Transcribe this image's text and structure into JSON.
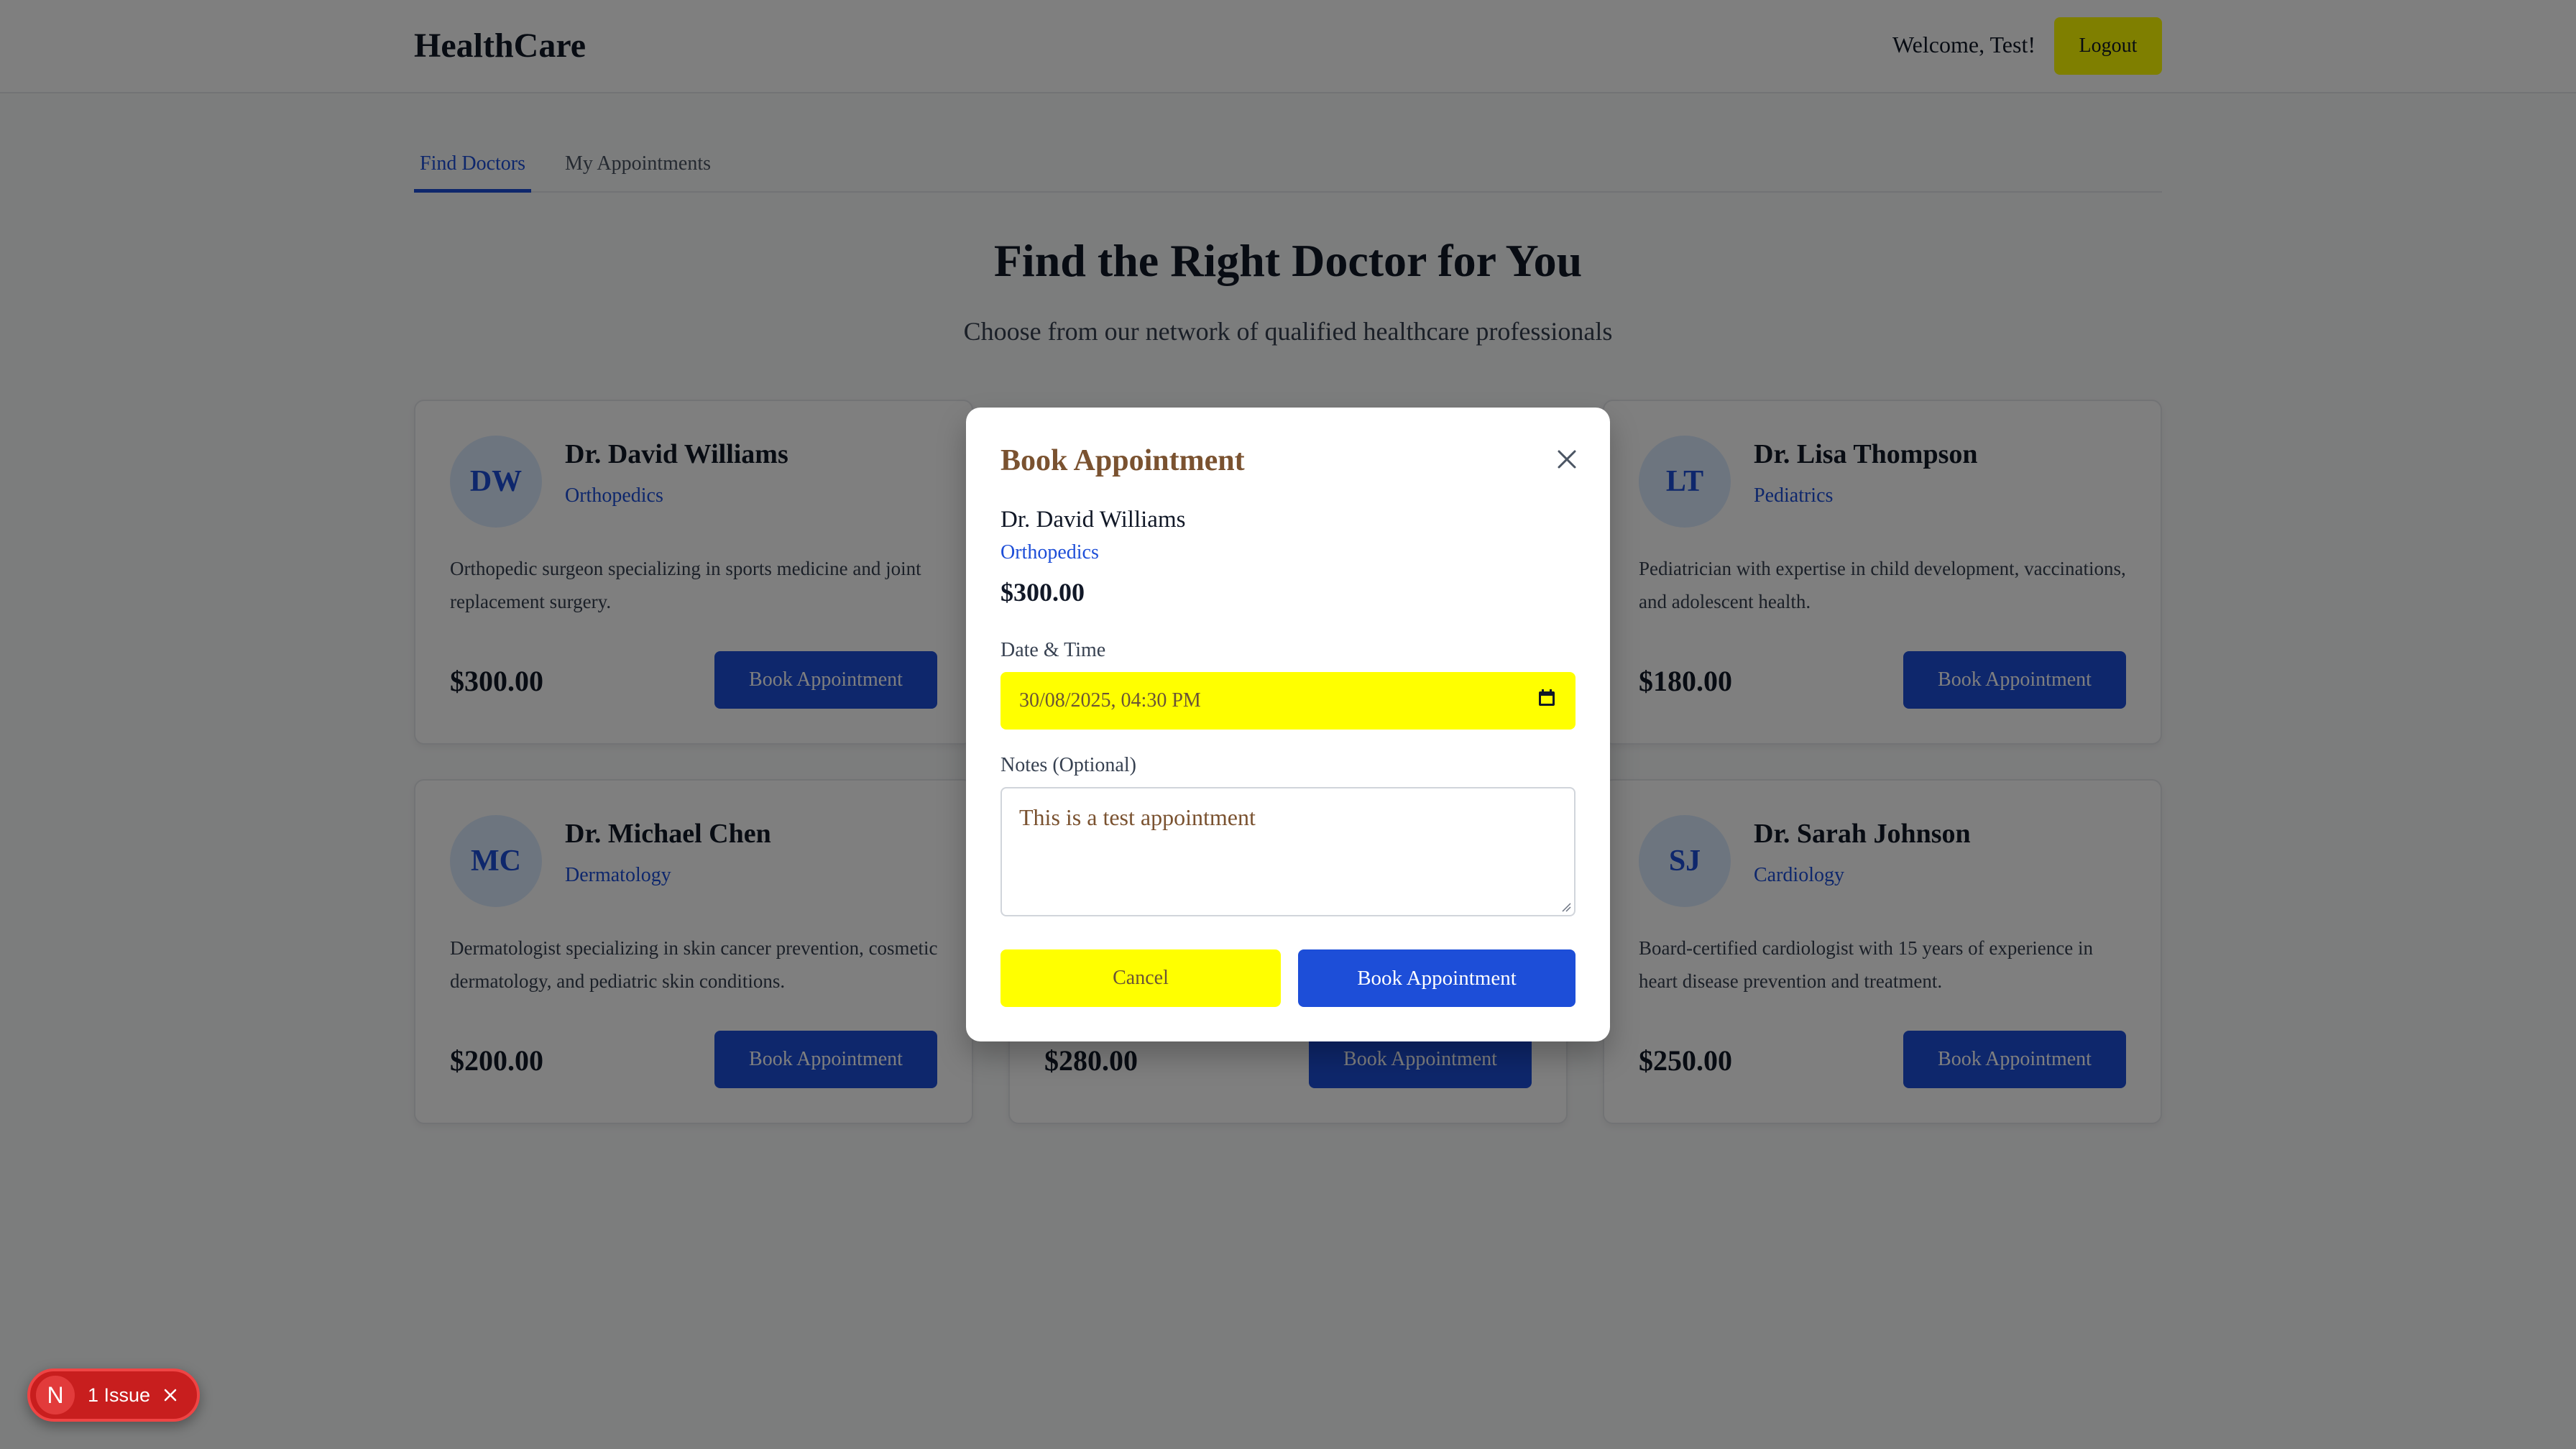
{
  "header": {
    "brand": "HealthCare",
    "welcome": "Welcome, Test!",
    "logout_label": "Logout"
  },
  "tabs": [
    {
      "label": "Find Doctors",
      "active": true
    },
    {
      "label": "My Appointments",
      "active": false
    }
  ],
  "hero": {
    "title": "Find the Right Doctor for You",
    "subtitle": "Choose from our network of qualified healthcare professionals"
  },
  "doctors": [
    {
      "initials": "DW",
      "name": "Dr. David Williams",
      "specialty": "Orthopedics",
      "description": "Orthopedic surgeon specializing in sports medicine and joint replacement surgery.",
      "price": "$300.00",
      "button": "Book Appointment"
    },
    {
      "initials": "LT",
      "name": "Dr. Lisa Thompson",
      "specialty": "Pediatrics",
      "description": "Pediatrician with expertise in child development, vaccinations, and adolescent health.",
      "price": "$180.00",
      "button": "Book Appointment"
    },
    {
      "initials": "MC",
      "name": "Dr. Michael Chen",
      "specialty": "Dermatology",
      "description": "Dermatologist specializing in skin cancer prevention, cosmetic dermatology, and pediatric skin conditions.",
      "price": "$200.00",
      "button": "Book Appointment"
    },
    {
      "price": "$280.00",
      "button": "Book Appointment"
    },
    {
      "initials": "SJ",
      "name": "Dr. Sarah Johnson",
      "specialty": "Cardiology",
      "description": "Board-certified cardiologist with 15 years of experience in heart disease prevention and treatment.",
      "price": "$250.00",
      "button": "Book Appointment"
    }
  ],
  "modal": {
    "title": "Book Appointment",
    "doctor_name": "Dr. David Williams",
    "specialty": "Orthopedics",
    "price": "$300.00",
    "datetime_label": "Date & Time",
    "datetime_value": "30/08/2025, 04:30  PM",
    "notes_label": "Notes (Optional)",
    "notes_value": "This is a test appointment",
    "cancel_label": "Cancel",
    "book_label": "Book Appointment"
  },
  "issue_badge": {
    "letter": "N",
    "text": "1 Issue"
  },
  "colors": {
    "primary": "#1d4ed8",
    "highlight": "#ffff00",
    "modal_title": "#7a5230",
    "issue_red": "#c81e1e"
  },
  "icons": [
    "close-icon",
    "calendar-icon",
    "issue-close-icon"
  ]
}
